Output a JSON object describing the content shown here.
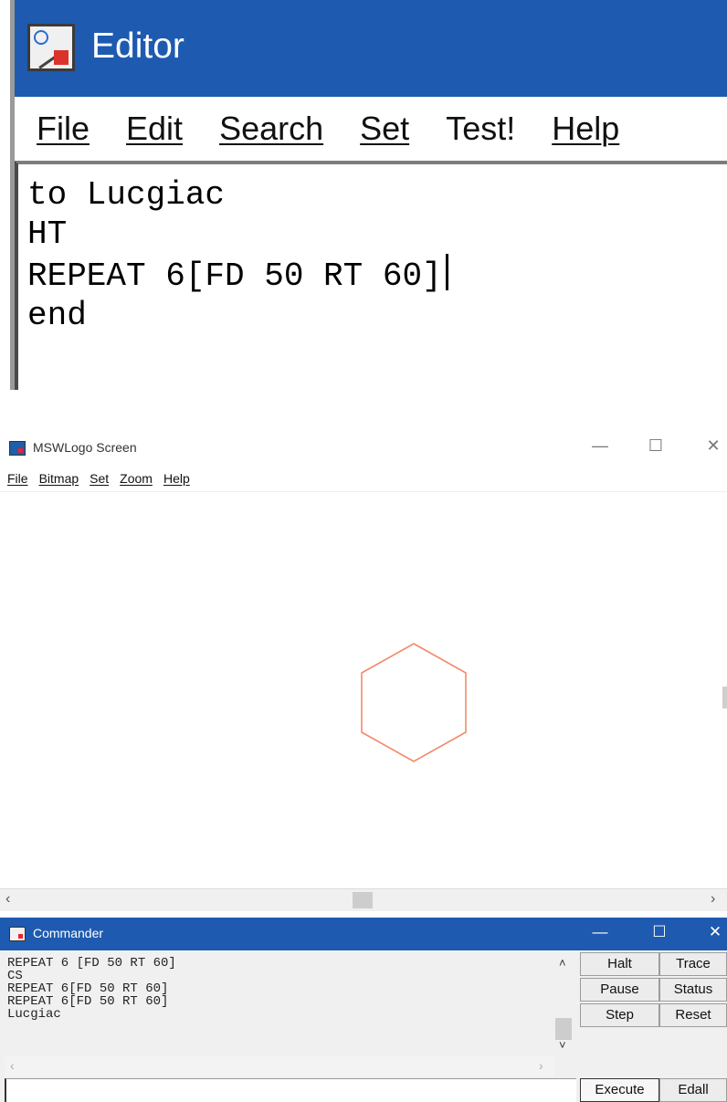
{
  "editor": {
    "title": "Editor",
    "menu": [
      "File",
      "Edit",
      "Search",
      "Set",
      "Test!",
      "Help"
    ],
    "code_lines": [
      "to Lucgiac",
      "HT",
      "REPEAT 6[FD 50 RT 60]",
      "end"
    ]
  },
  "logo_screen": {
    "title": "MSWLogo Screen",
    "menu": [
      "File",
      "Bitmap",
      "Set",
      "Zoom",
      "Help"
    ],
    "window_controls": {
      "minimize": "—",
      "maximize": "☐",
      "close": "✕"
    },
    "drawing": {
      "shape": "hexagon",
      "pen_color": "#f08a6a"
    },
    "scroll_left": "‹",
    "scroll_right": "›"
  },
  "commander": {
    "title": "Commander",
    "window_controls": {
      "minimize": "—",
      "maximize": "☐",
      "close": "✕"
    },
    "history": [
      "REPEAT 6 [FD 50 RT 60]",
      "CS",
      "REPEAT 6[FD 50 RT 60]",
      "REPEAT 6[FD 50 RT 60]",
      "Lucgiac"
    ],
    "input_value": "",
    "buttons": {
      "halt": "Halt",
      "trace": "Trace",
      "pause": "Pause",
      "status": "Status",
      "step": "Step",
      "reset": "Reset",
      "execute": "Execute",
      "edall": "Edall"
    },
    "scroll_up": "˄",
    "scroll_down": "˅",
    "scroll_left": "‹",
    "scroll_right": "›"
  },
  "colors": {
    "titlebar_blue": "#1e5ab0",
    "pen": "#f08a6a"
  }
}
